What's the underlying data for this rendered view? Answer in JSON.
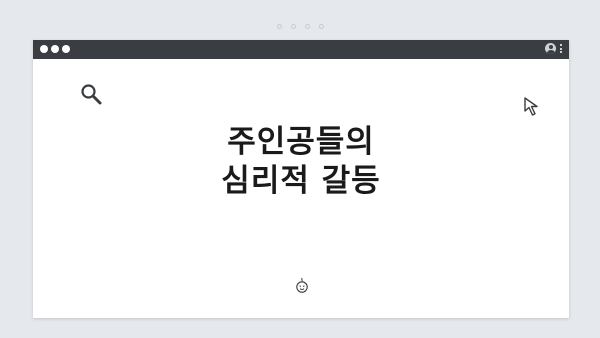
{
  "pager": {
    "dots": 4
  },
  "window": {
    "titlebar": {
      "lights": [
        "light-1",
        "light-2",
        "light-3"
      ],
      "icons": [
        "user-avatar-icon",
        "kebab-menu-icon"
      ]
    },
    "content": {
      "title_line1": "주인공들의",
      "title_line2": "심리적 갈등",
      "icons": [
        "search-icon",
        "cursor-arrow-icon",
        "baby-face-icon"
      ]
    }
  },
  "colors": {
    "background": "#e5e8ec",
    "titlebar": "#3a3d42",
    "window": "#ffffff",
    "text": "#1a1a1a"
  }
}
